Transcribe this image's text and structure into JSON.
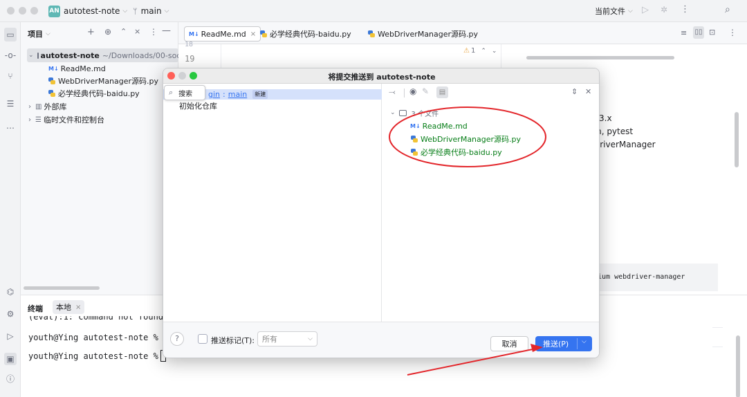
{
  "titlebar": {
    "project_badge": "AN",
    "project_name": "autotest-note",
    "branch": "main",
    "run_config": "当前文件"
  },
  "project_panel": {
    "title": "项目",
    "root_name": "autotest-note",
    "root_path": "~/Downloads/00-social",
    "files": [
      "ReadMe.md",
      "WebDriverManager源码.py",
      "必学经典代码-baidu.py"
    ],
    "external_libs": "外部库",
    "scratches": "临时文件和控制台"
  },
  "editor": {
    "tabs": [
      "ReadMe.md",
      "必学经典代码-baidu.py",
      "WebDriverManager源码.py"
    ],
    "line_numbers": [
      "18",
      "19"
    ],
    "warning_count": "1",
    "preview_lines": [
      "3.x",
      "m, pytest",
      "DriverManager"
    ],
    "code_snippet": "ium webdriver-manager"
  },
  "terminal": {
    "title": "终端",
    "tab_label": "本地",
    "lines": [
      "(evat):1: command not found",
      "youth@Ying autotest-note % ",
      "youth@Ying autotest-note % "
    ]
  },
  "dialog": {
    "title": "将提交推送到 autotest-note",
    "search_placeholder": "搜索",
    "branch_fragment": "gin",
    "branch_separator": ":",
    "branch_target": "main",
    "new_badge": "新建",
    "commit_message": "初始化仓库",
    "folder_label": "3 个文件",
    "files": [
      "ReadMe.md",
      "WebDriverManager源码.py",
      "必学经典代码-baidu.py"
    ],
    "help": "?",
    "push_tags_label": "推送标记(T):",
    "push_tags_value": "所有",
    "cancel": "取消",
    "push": "推送(P)"
  },
  "colors": {
    "accent": "#3574f0",
    "added_file_green": "#067d17",
    "annotation_red": "#e3262b",
    "selection": "#d5e1fb"
  }
}
